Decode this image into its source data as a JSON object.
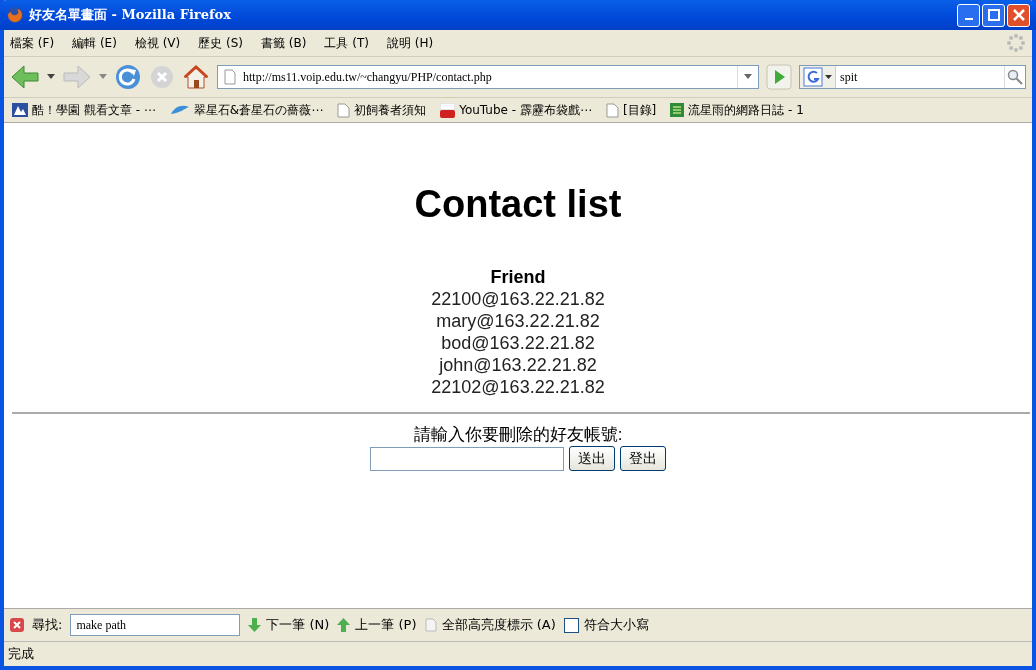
{
  "window": {
    "title": "好友名單畫面 - Mozilla Firefox"
  },
  "menu": [
    "檔案 (F)",
    "編輯 (E)",
    "檢視 (V)",
    "歷史 (S)",
    "書籤 (B)",
    "工具 (T)",
    "說明 (H)"
  ],
  "address": {
    "value": "http://ms11.voip.edu.tw/~changyu/PHP/contact.php"
  },
  "search": {
    "value": "spit"
  },
  "bookmarks": [
    {
      "label": "酷！學園 觀看文章 - ⋯",
      "kind": "site"
    },
    {
      "label": "翠星石&蒼星石の薔薇⋯",
      "kind": "bird"
    },
    {
      "label": "初飼養者須知",
      "kind": "page"
    },
    {
      "label": "YouTube - 霹靂布袋戲⋯",
      "kind": "youtube"
    },
    {
      "label": "[目錄]",
      "kind": "page"
    },
    {
      "label": "流星雨的網路日誌 - 1",
      "kind": "blog"
    }
  ],
  "page": {
    "heading": "Contact list",
    "list_heading": "Friend",
    "friends": [
      "22100@163.22.21.82",
      "mary@163.22.21.82",
      "bod@163.22.21.82",
      "john@163.22.21.82",
      "22102@163.22.21.82"
    ],
    "prompt": "請輸入你要刪除的好友帳號:",
    "buttons": [
      "送出",
      "登出"
    ]
  },
  "find_bar": {
    "label": "尋找:",
    "value": "make path",
    "next": "下一筆 (N)",
    "previous": "上一筆 (P)",
    "highlight": "全部高亮度標示 (A)",
    "match_case": {
      "label": "符合大小寫",
      "checked": false
    }
  },
  "status_bar": "完成"
}
